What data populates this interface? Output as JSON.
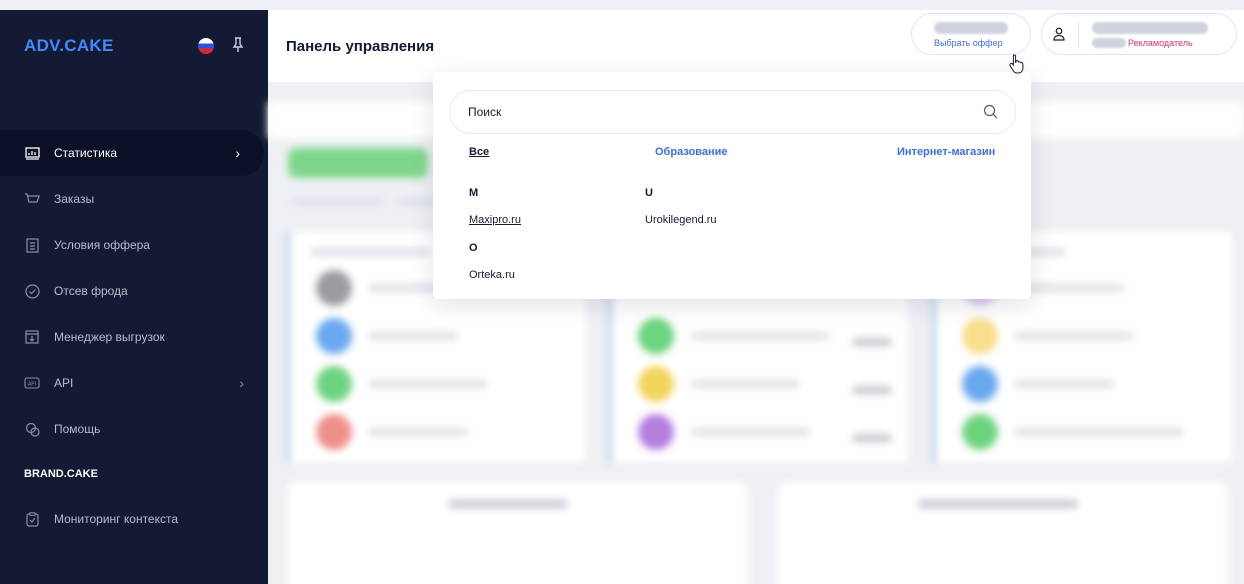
{
  "sidebar": {
    "logo": "ADV.CAKE",
    "items": [
      {
        "label": "Статистика",
        "icon": "chart-icon",
        "has_chevron": true
      },
      {
        "label": "Заказы",
        "icon": "cart-icon"
      },
      {
        "label": "Условия оффера",
        "icon": "document-icon"
      },
      {
        "label": "Отсев фрода",
        "icon": "shield-icon"
      },
      {
        "label": "Менеджер выгрузок",
        "icon": "download-icon"
      },
      {
        "label": "API",
        "icon": "api-icon",
        "has_chevron": true
      },
      {
        "label": "Помощь",
        "icon": "help-icon"
      }
    ],
    "section_title": "BRAND.CAKE",
    "section_item": {
      "label": "Мониторинг контекста",
      "icon": "clipboard-icon"
    }
  },
  "header": {
    "title": "Панель управления",
    "offer_button": "Выбрать оффер",
    "user_role": "Рекламодатель"
  },
  "dropdown": {
    "search_placeholder": "Поиск",
    "filters": [
      "Все",
      "Образование",
      "Интернет-магазин"
    ],
    "groups": [
      {
        "letter": "M",
        "sites": [
          "Maxipro.ru"
        ]
      },
      {
        "letter": "U",
        "sites": [
          "Urokilegend.ru"
        ]
      },
      {
        "letter": "O",
        "sites": [
          "Orteka.ru"
        ]
      }
    ]
  },
  "colors": {
    "sidebar_bg": "#141a33",
    "accent": "#3d6fe0",
    "role": "#e0336a"
  }
}
